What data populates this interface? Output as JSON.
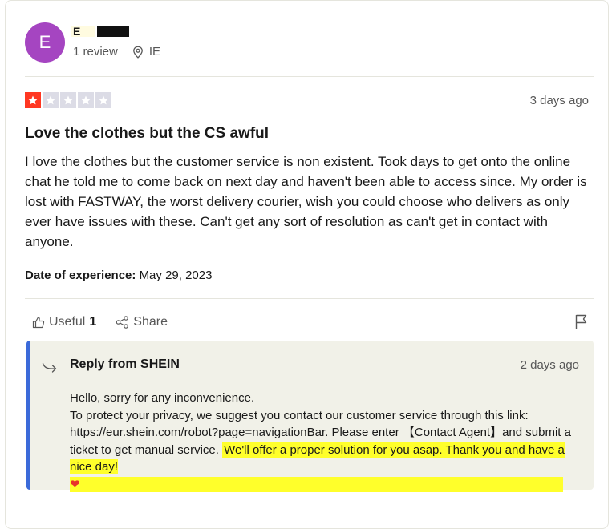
{
  "reviewer": {
    "avatar_letter": "E",
    "avatar_color": "#a545c1",
    "name_visible": "E",
    "review_count": "1 review",
    "country": "IE"
  },
  "review": {
    "rating": 1,
    "rating_max": 5,
    "star_filled_color": "#ff3722",
    "star_empty_color": "#dcdce6",
    "posted": "3 days ago",
    "title": "Love the clothes but the CS awful",
    "body": "I love the clothes but the customer service is non existent. Took days to get onto the online chat he told me to come back on next day and haven't been able to access since. My order is lost with FASTWAY, the worst delivery courier, wish you could choose who delivers as only ever have issues with these. Can't get any sort of resolution as can't get in contact with anyone.",
    "date_of_experience_label": "Date of experience:",
    "date_of_experience": "May 29, 2023"
  },
  "actions": {
    "useful_label": "Useful",
    "useful_count": "1",
    "share_label": "Share"
  },
  "reply": {
    "from_label": "Reply from SHEIN",
    "posted": "2 days ago",
    "line1": "Hello, sorry for any inconvenience.",
    "line2": "To protect your privacy, we suggest you contact our customer service through this link: https://eur.shein.com/robot?page=navigationBar. Please enter 【Contact Agent】and submit a ticket to get manual service. ",
    "highlighted": "We'll offer a proper solution for you asap. Thank you and have a nice day!",
    "heart": "❤",
    "highlight_color": "#ffff2b",
    "accent_color": "#3b6ad9"
  },
  "icons": [
    "location-pin-icon",
    "thumbs-up-icon",
    "share-icon",
    "flag-icon",
    "reply-arrow-icon",
    "star-icon"
  ]
}
